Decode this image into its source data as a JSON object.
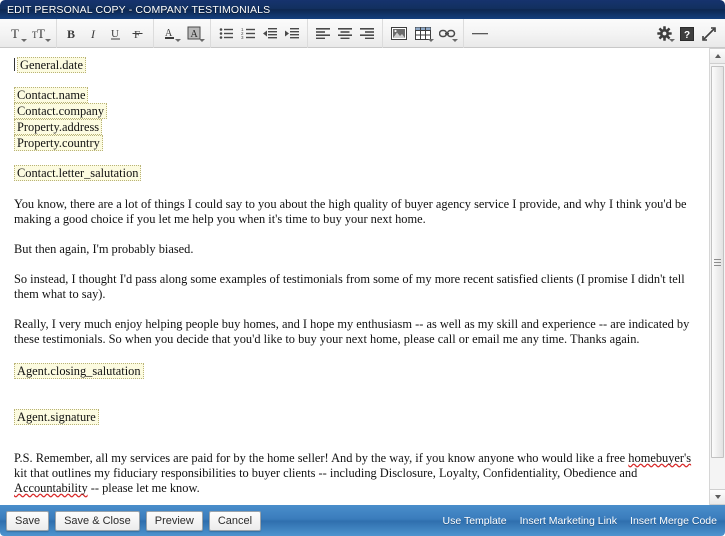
{
  "window": {
    "title": "EDIT PERSONAL COPY - COMPANY TESTIMONIALS"
  },
  "toolbar": {
    "groups": [
      {
        "name": "font-group",
        "items": [
          {
            "name": "font-size-button",
            "icon": "font-size-icon",
            "label": "Font Size",
            "dropdown": true
          },
          {
            "name": "font-name-button",
            "icon": "font-name-icon",
            "label": "Font",
            "dropdown": true
          }
        ]
      },
      {
        "name": "text-style-group",
        "items": [
          {
            "name": "bold-button",
            "icon": "bold-icon",
            "label": "Bold",
            "dropdown": false
          },
          {
            "name": "italic-button",
            "icon": "italic-icon",
            "label": "Italic",
            "dropdown": false
          },
          {
            "name": "underline-button",
            "icon": "underline-icon",
            "label": "Underline",
            "dropdown": false
          },
          {
            "name": "strikethrough-button",
            "icon": "strikethrough-icon",
            "label": "Strikethrough",
            "dropdown": false
          }
        ]
      },
      {
        "name": "color-group",
        "items": [
          {
            "name": "text-color-button",
            "icon": "text-color-icon",
            "label": "Text Color",
            "dropdown": true
          },
          {
            "name": "highlight-color-button",
            "icon": "highlight-color-icon",
            "label": "Background Color",
            "dropdown": true
          }
        ]
      },
      {
        "name": "list-group",
        "items": [
          {
            "name": "bullet-list-button",
            "icon": "bullet-list-icon",
            "label": "Bulleted List",
            "dropdown": false
          },
          {
            "name": "numbered-list-button",
            "icon": "numbered-list-icon",
            "label": "Numbered List",
            "dropdown": false
          },
          {
            "name": "decrease-indent-button",
            "icon": "decrease-indent-icon",
            "label": "Decrease Indent",
            "dropdown": false
          },
          {
            "name": "increase-indent-button",
            "icon": "increase-indent-icon",
            "label": "Increase Indent",
            "dropdown": false
          }
        ]
      },
      {
        "name": "align-group",
        "items": [
          {
            "name": "align-left-button",
            "icon": "align-left-icon",
            "label": "Align Left",
            "dropdown": false
          },
          {
            "name": "align-center-button",
            "icon": "align-center-icon",
            "label": "Align Center",
            "dropdown": false
          },
          {
            "name": "align-right-button",
            "icon": "align-right-icon",
            "label": "Align Right",
            "dropdown": false
          }
        ]
      },
      {
        "name": "insert-group",
        "items": [
          {
            "name": "insert-image-button",
            "icon": "image-icon",
            "label": "Insert Image",
            "dropdown": false
          },
          {
            "name": "insert-table-button",
            "icon": "table-icon",
            "label": "Insert Table",
            "dropdown": true
          },
          {
            "name": "insert-link-button",
            "icon": "link-icon",
            "label": "Insert Link",
            "dropdown": true
          }
        ]
      },
      {
        "name": "rule-group",
        "items": [
          {
            "name": "horizontal-rule-button",
            "icon": "horizontal-rule-icon",
            "label": "Horizontal Rule",
            "dropdown": false
          }
        ]
      }
    ],
    "right_items": [
      {
        "name": "settings-button",
        "icon": "gear-icon",
        "label": "Settings",
        "dropdown": true
      },
      {
        "name": "help-button",
        "icon": "help-icon",
        "label": "Help",
        "dropdown": false
      },
      {
        "name": "fullscreen-button",
        "icon": "fullscreen-icon",
        "label": "Maximize",
        "dropdown": false
      }
    ]
  },
  "document": {
    "merge_tags": {
      "general_date": "General.date",
      "contact_name": "Contact.name",
      "contact_company": "Contact.company",
      "property_address": "Property.address",
      "property_country": "Property.country",
      "contact_letter_salutation": "Contact.letter_salutation",
      "agent_closing_salutation": "Agent.closing_salutation",
      "agent_signature": "Agent.signature"
    },
    "paragraphs": {
      "p1": "You know, there are a lot of things I could say to you about the high quality of buyer agency service I provide, and why I think you'd be making a good choice if you let me help you when it's time to buy your next home.",
      "p2": "But then again, I'm probably biased.",
      "p3": "So instead, I thought I'd pass along some examples of testimonials from some of my more recent satisfied clients (I promise I didn't tell them what to say).",
      "p4": "Really, I very much enjoy helping people buy homes, and I hope my enthusiasm -- as well as my skill and experience -- are indicated by these testimonials. So when you decide that you'd like to buy your next home, please call or email me any time. Thanks again.",
      "ps_part1": "P.S. Remember, all my services are paid for by the home seller! And by the way, if you know anyone who would like a free ",
      "ps_misspell1": "homebuyer's",
      "ps_part2": " kit that outlines my fiduciary responsibilities to buyer clients -- including Disclosure, Loyalty, Confidentiality, Obedience and ",
      "ps_misspell2": "Accountability",
      "ps_part3": " -- please let me know."
    }
  },
  "scrollbar": {
    "up_arrow_label": "Scroll Up",
    "down_arrow_label": "Scroll Down",
    "thumb_label": "Vertical Scroll Thumb"
  },
  "footer": {
    "buttons": [
      {
        "name": "save-button",
        "label": "Save"
      },
      {
        "name": "save-and-close-button",
        "label": "Save & Close"
      },
      {
        "name": "preview-button",
        "label": "Preview"
      },
      {
        "name": "cancel-button",
        "label": "Cancel"
      }
    ],
    "links": [
      {
        "name": "use-template-link",
        "label": "Use Template"
      },
      {
        "name": "insert-marketing-link",
        "label": "Insert Marketing Link"
      },
      {
        "name": "insert-merge-code-link",
        "label": "Insert Merge Code"
      }
    ]
  },
  "colors": {
    "titlebar": "#12305f",
    "footer": "#3a7cbc",
    "merge_tag_bg": "#fcfbe0",
    "merge_tag_border": "#b9b377",
    "spellcheck": "#d92b2b"
  }
}
